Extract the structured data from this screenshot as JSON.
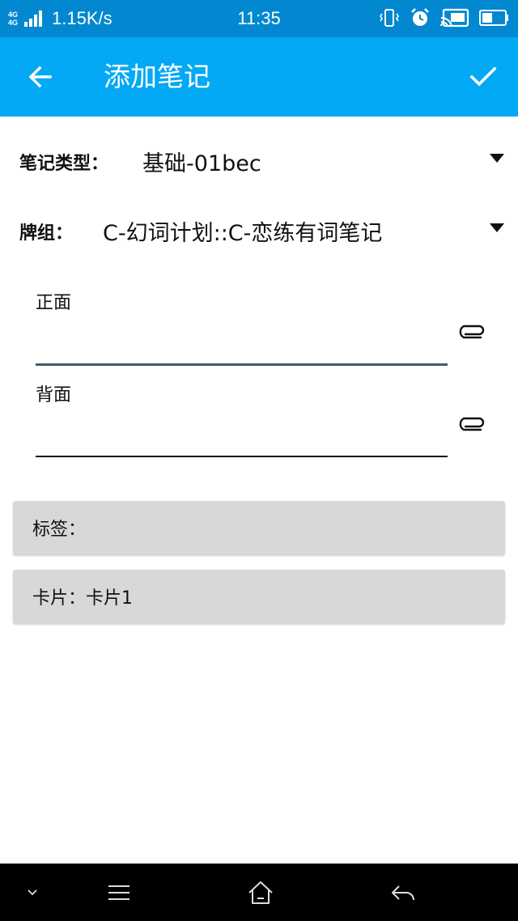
{
  "status_bar": {
    "network_type": "4G",
    "network_type_2": "4G",
    "net_speed": "1.15K/s",
    "time": "11:35",
    "icons": [
      "signal-bars-icon",
      "vibrate-icon",
      "alarm-icon",
      "cast-icon",
      "battery-icon"
    ],
    "battery_level": 0.45
  },
  "app_bar": {
    "title": "添加笔记",
    "back_icon": "arrow-back-icon",
    "confirm_icon": "check-icon",
    "background": "#03a9f4"
  },
  "form": {
    "note_type": {
      "label": "笔记类型：",
      "value": "基础-01bec"
    },
    "deck": {
      "label": "牌组：",
      "value": "C-幻词计划::C-恋练有词笔记"
    },
    "fields": [
      {
        "label": "正面",
        "value": "",
        "attach_icon": "paperclip-icon"
      },
      {
        "label": "背面",
        "value": "",
        "attach_icon": "paperclip-icon"
      }
    ],
    "tags_button": "标签：",
    "cards_button": "卡片：卡片1"
  },
  "nav_bar": {
    "icons": [
      "chevron-down-icon",
      "menu-icon",
      "home-icon",
      "back-icon"
    ]
  },
  "colors": {
    "status_bar": "#0288d1",
    "app_bar": "#03a9f4",
    "button_gray": "#d7d8d7",
    "active_underline": "#455a64"
  }
}
